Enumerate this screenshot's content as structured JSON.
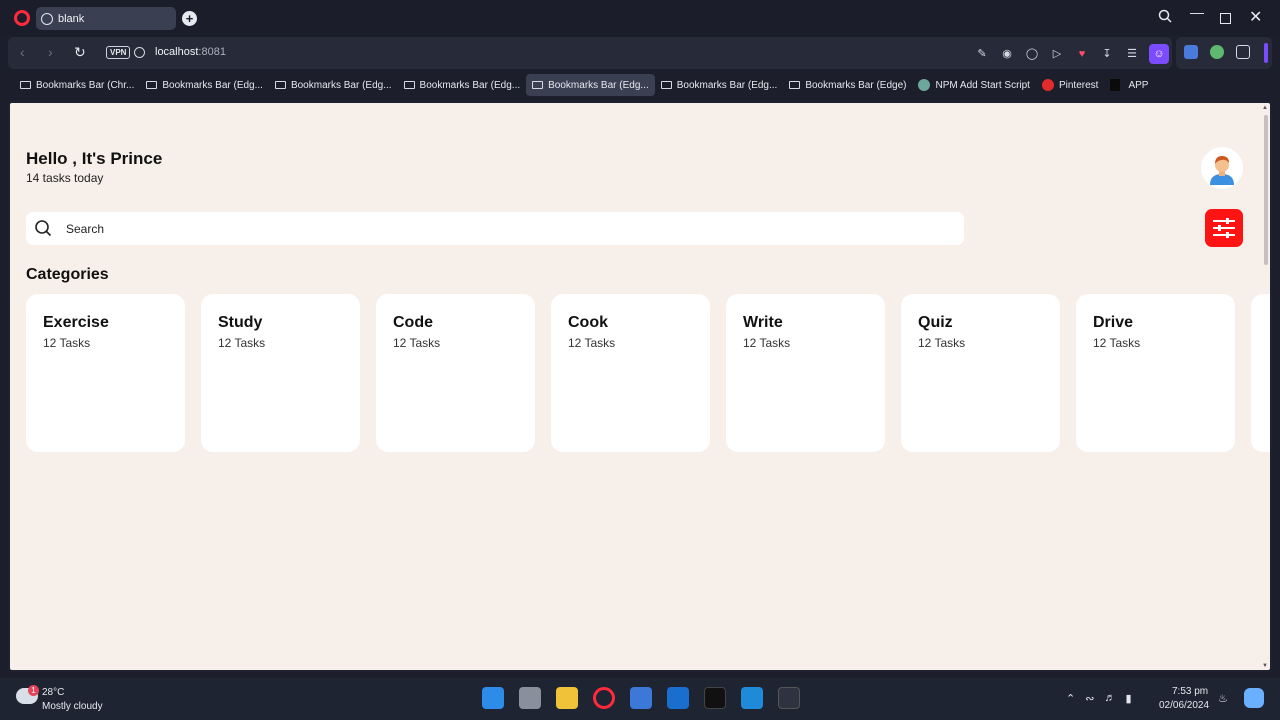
{
  "browser": {
    "tab_title": "blank",
    "new_tab_symbol": "+",
    "vpn_label": "VPN",
    "url_host": "localhost",
    "url_port": ":8081",
    "bookmarks": [
      {
        "label": "Bookmarks Bar (Chr...",
        "icon": "folder-icon"
      },
      {
        "label": "Bookmarks Bar (Edg...",
        "icon": "folder-icon"
      },
      {
        "label": "Bookmarks Bar (Edg...",
        "icon": "folder-icon"
      },
      {
        "label": "Bookmarks Bar (Edg...",
        "icon": "folder-icon"
      },
      {
        "label": "Bookmarks Bar (Edg...",
        "icon": "folder-icon"
      },
      {
        "label": "Bookmarks Bar (Edg...",
        "icon": "folder-icon"
      },
      {
        "label": "Bookmarks Bar (Edge)",
        "icon": "folder-icon"
      },
      {
        "label": "NPM Add Start Script",
        "icon": "chatgpt-icon"
      },
      {
        "label": "Pinterest",
        "icon": "pinterest-icon"
      },
      {
        "label": "APP",
        "icon": "file-icon"
      }
    ]
  },
  "app": {
    "greeting": "Hello , It's Prince",
    "tasks_today": "14 tasks today",
    "search_placeholder": "Search",
    "categories_title": "Categories",
    "accent_color": "#ff1414",
    "background_color": "#f7efe9",
    "categories": [
      {
        "name": "Exercise",
        "count": "12 Tasks"
      },
      {
        "name": "Study",
        "count": "12 Tasks"
      },
      {
        "name": "Code",
        "count": "12 Tasks"
      },
      {
        "name": "Cook",
        "count": "12 Tasks"
      },
      {
        "name": "Write",
        "count": "12 Tasks"
      },
      {
        "name": "Quiz",
        "count": "12 Tasks"
      },
      {
        "name": "Drive",
        "count": "12 Tasks"
      }
    ]
  },
  "taskbar": {
    "weather_badge": "1",
    "temperature": "28°C",
    "condition": "Mostly cloudy",
    "time": "7:53 pm",
    "date": "02/06/2024"
  }
}
